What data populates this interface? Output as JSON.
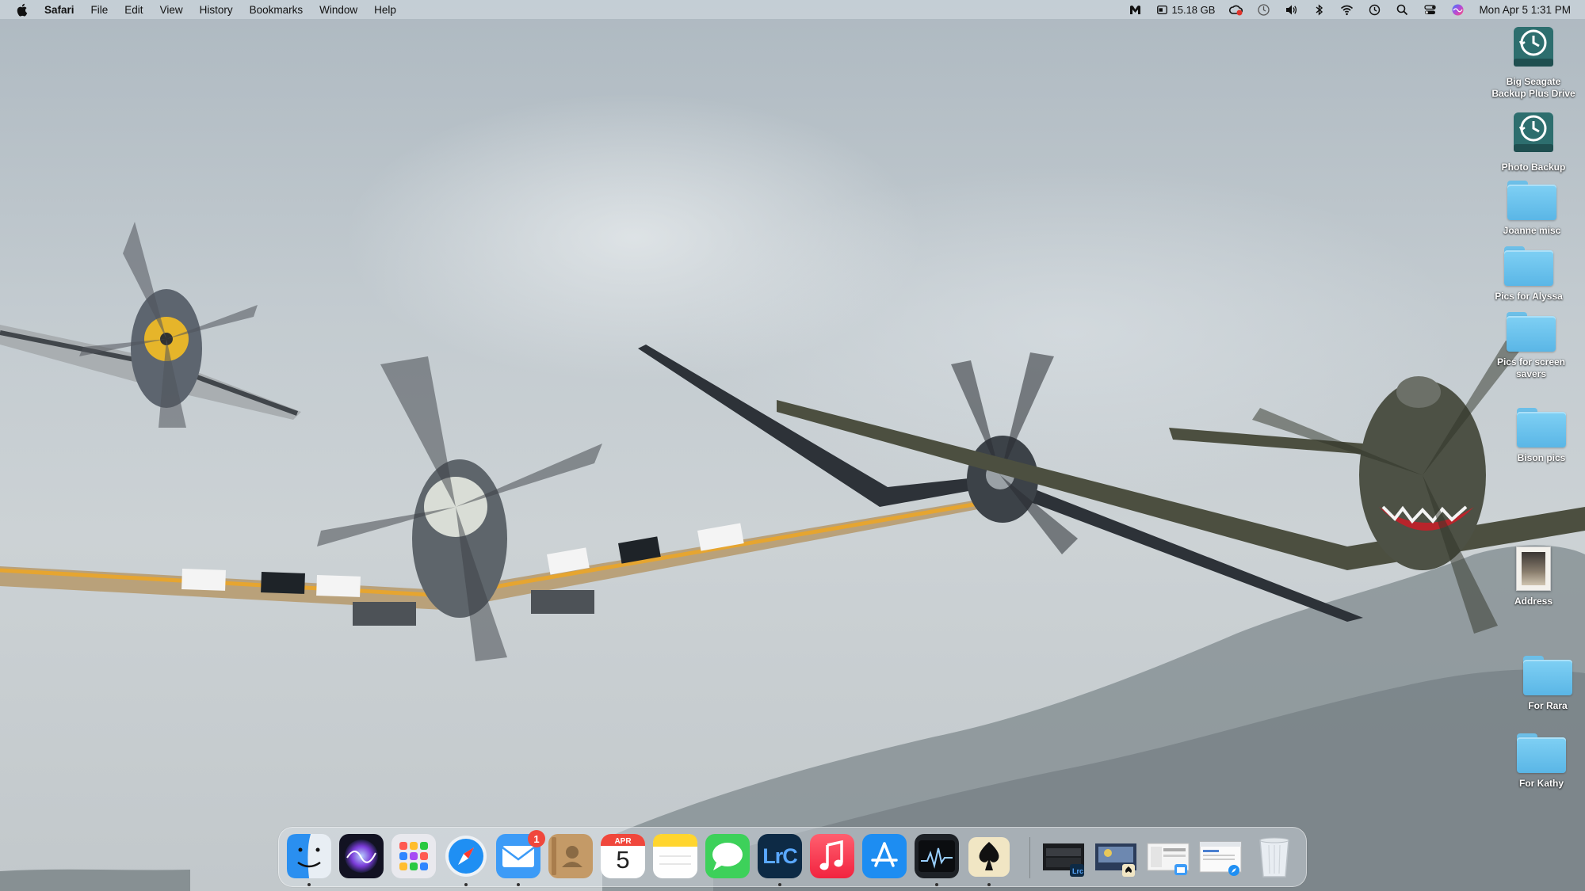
{
  "menubar": {
    "apple_icon": "apple-logo",
    "items": [
      "Safari",
      "File",
      "Edit",
      "View",
      "History",
      "Bookmarks",
      "Window",
      "Help"
    ],
    "status": {
      "storage": "15.18 GB",
      "clock": "Mon Apr 5  1:31 PM"
    }
  },
  "desktop_icons": [
    {
      "label": "Big Seagate\nBackup Plus Drive",
      "kind": "time-machine-drive"
    },
    {
      "label": "Photo Backup",
      "kind": "time-machine-drive"
    },
    {
      "label": "Joanne misc",
      "kind": "folder"
    },
    {
      "label": "Pics for Alyssa",
      "kind": "folder"
    },
    {
      "label": "Pics for screen\nsavers",
      "kind": "folder"
    },
    {
      "label": "Bison pics",
      "kind": "folder"
    },
    {
      "label": "Address",
      "kind": "document"
    },
    {
      "label": "For Rara",
      "kind": "folder"
    },
    {
      "label": "For Kathy",
      "kind": "folder"
    }
  ],
  "dock": {
    "apps": [
      {
        "name": "Finder",
        "running": true
      },
      {
        "name": "Siri",
        "running": false
      },
      {
        "name": "Launchpad",
        "running": false
      },
      {
        "name": "Safari",
        "running": true
      },
      {
        "name": "Mail",
        "running": true,
        "badge": "1"
      },
      {
        "name": "Contacts",
        "running": false
      },
      {
        "name": "Calendar",
        "running": false,
        "month": "APR",
        "day": "5"
      },
      {
        "name": "Notes",
        "running": false
      },
      {
        "name": "Messages",
        "running": false
      },
      {
        "name": "Lightroom Classic",
        "running": true,
        "text": "LrC"
      },
      {
        "name": "Music",
        "running": false
      },
      {
        "name": "App Store",
        "running": false
      },
      {
        "name": "Activity Monitor",
        "running": true
      },
      {
        "name": "Solitaire",
        "running": true
      }
    ],
    "minimized": [
      "Lightroom window",
      "Photo window",
      "Mail window",
      "Safari window"
    ],
    "trash": "Trash"
  },
  "colors": {
    "folder_blue": "#6cbfe8",
    "badge_red": "#f0473c"
  }
}
